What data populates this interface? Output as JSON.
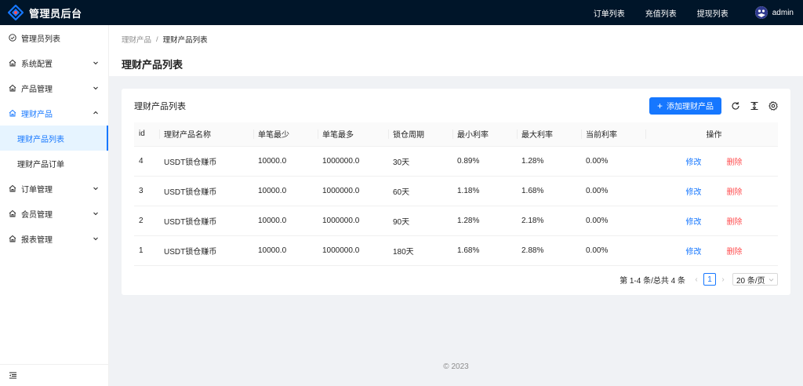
{
  "app": {
    "title": "管理员后台"
  },
  "topnav": {
    "links": [
      "订单列表",
      "充值列表",
      "提现列表"
    ],
    "user": "admin"
  },
  "sidebar": {
    "items": [
      {
        "label": "管理员列表",
        "icon": "check-circle-icon",
        "expandable": false
      },
      {
        "label": "系统配置",
        "icon": "home-icon",
        "expandable": true
      },
      {
        "label": "产品管理",
        "icon": "home-icon",
        "expandable": true
      },
      {
        "label": "理财产品",
        "icon": "home-icon",
        "expandable": true,
        "open": true,
        "children": [
          "理财产品列表",
          "理财产品订单"
        ]
      },
      {
        "label": "订单管理",
        "icon": "home-icon",
        "expandable": true
      },
      {
        "label": "会员管理",
        "icon": "home-icon",
        "expandable": true
      },
      {
        "label": "报表管理",
        "icon": "home-icon",
        "expandable": true
      }
    ],
    "selected": "理财产品列表"
  },
  "breadcrumb": [
    "理财产品",
    "理财产品列表"
  ],
  "page_title": "理财产品列表",
  "card": {
    "title": "理财产品列表",
    "add_button": "添加理财产品"
  },
  "table": {
    "columns": [
      "id",
      "理财产品名称",
      "单笔最少",
      "单笔最多",
      "锁仓周期",
      "最小利率",
      "最大利率",
      "当前利率",
      "操作"
    ],
    "rows": [
      [
        "4",
        "USDT锁仓赚币",
        "10000.0",
        "1000000.0",
        "30天",
        "0.89%",
        "1.28%",
        "0.00%"
      ],
      [
        "3",
        "USDT锁仓赚币",
        "10000.0",
        "1000000.0",
        "60天",
        "1.18%",
        "1.68%",
        "0.00%"
      ],
      [
        "2",
        "USDT锁仓赚币",
        "10000.0",
        "1000000.0",
        "90天",
        "1.28%",
        "2.18%",
        "0.00%"
      ],
      [
        "1",
        "USDT锁仓赚币",
        "10000.0",
        "1000000.0",
        "180天",
        "1.68%",
        "2.88%",
        "0.00%"
      ]
    ],
    "edit_label": "修改",
    "delete_label": "删除"
  },
  "pagination": {
    "total_text": "第 1-4 条/总共 4 条",
    "current_page": "1",
    "page_size": "20 条/页"
  },
  "footer": "© 2023",
  "colors": {
    "header_bg": "#001529",
    "primary": "#1677ff",
    "danger": "#ff4d4f"
  }
}
